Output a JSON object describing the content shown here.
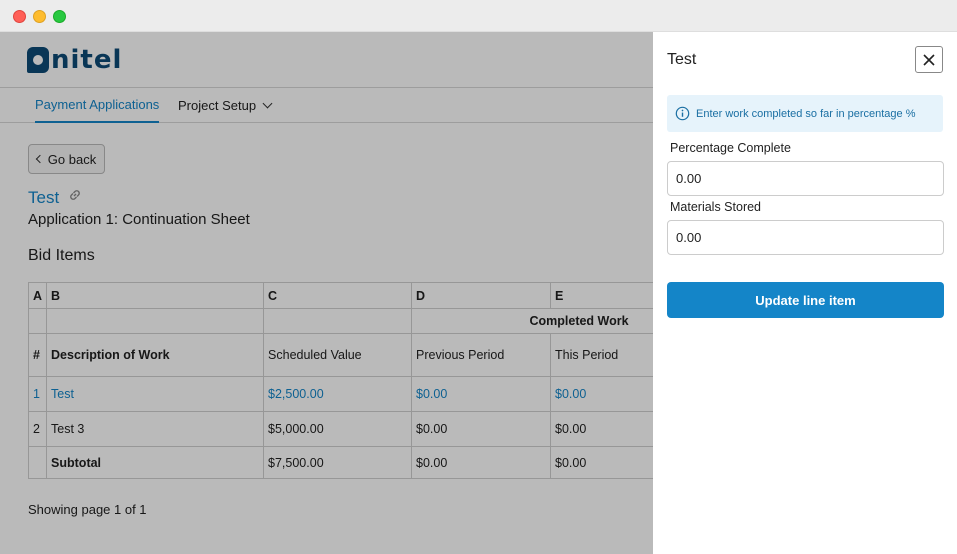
{
  "app": {
    "logo_text": "nitel",
    "nav": {
      "tabs": [
        {
          "label": "Payment Applications"
        },
        {
          "label": "Project Setup"
        }
      ]
    },
    "back_label": "Go back",
    "project_title": "Test",
    "subtitle": "Application 1: Continuation Sheet",
    "section_title": "Bid Items",
    "table": {
      "letters": [
        "A",
        "B",
        "C",
        "D",
        "E"
      ],
      "group_header": "Completed Work",
      "headers": [
        "#",
        "Description of Work",
        "Scheduled Value",
        "Previous Period",
        "This Period"
      ],
      "rows": [
        [
          "1",
          "Test",
          "$2,500.00",
          "$0.00",
          "$0.00"
        ],
        [
          "2",
          "Test 3",
          "$5,000.00",
          "$0.00",
          "$0.00"
        ]
      ],
      "subtotal": [
        "",
        "Subtotal",
        "$7,500.00",
        "$0.00",
        "$0.00"
      ]
    },
    "pager": "Showing page 1 of 1"
  },
  "panel": {
    "title": "Test",
    "info": "Enter work completed so far in percentage %",
    "percentage_label": "Percentage Complete",
    "percentage_value": "0.00",
    "materials_label": "Materials Stored",
    "materials_value": "0.00",
    "update_label": "Update line item"
  },
  "colors": {
    "accent": "#1485c8",
    "brand": "#0d4a77",
    "info_bg": "#e6f3fb"
  }
}
